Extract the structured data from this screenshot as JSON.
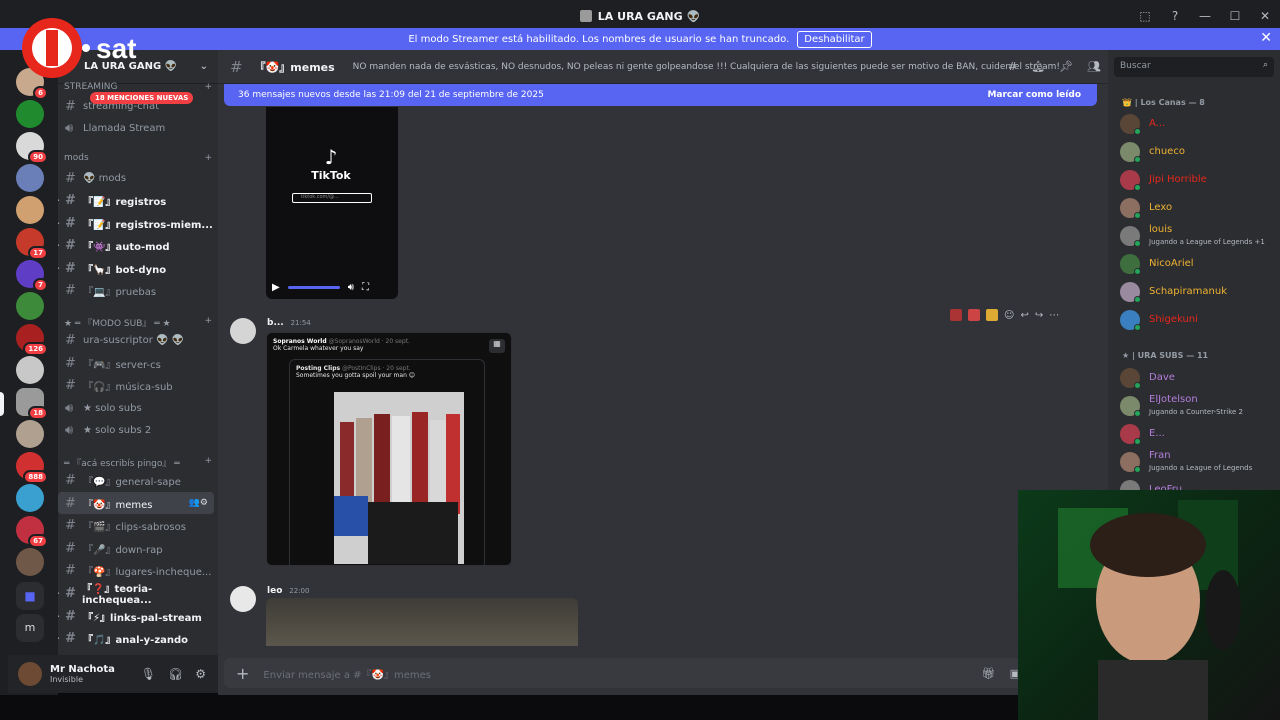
{
  "window": {
    "title": "LA URA GANG 👽",
    "controls": [
      "⬚",
      "?",
      "—",
      "☐",
      "✕"
    ]
  },
  "streamer_banner": {
    "text": "El modo Streamer está habilitado. Los nombres de usuario se han truncado.",
    "button": "Deshabilitar",
    "close": "✕"
  },
  "logo": {
    "text": "I.sat",
    "accent": "#e8271c"
  },
  "server_rail": {
    "badges": [
      "6",
      "90",
      "17",
      "7",
      "126",
      "18",
      "888",
      "67"
    ],
    "dm_label": "m"
  },
  "server": {
    "name": "LA URA GANG 👽",
    "mentions_pill": "18 MENCIONES NUEVAS"
  },
  "categories": {
    "streaming": "STREAMING",
    "mods": "mods",
    "modo_sub": "★ ═ 『MODO SUB』 ═ ★",
    "aca": "═ 『acá escribís pingo』 ═"
  },
  "channels": {
    "streaming_chat": "streaming-chat",
    "llamada_stream": "Llamada Stream",
    "mods": "👽 mods",
    "registros": "『📝』registros",
    "registros_miem": "『📝』registros-miem...",
    "auto_mod": "『👾』auto-mod",
    "bot_dyno": "『🦙』bot-dyno",
    "pruebas": "『💻』pruebas",
    "ura_suscriptor": "ura-suscriptor 👽 👽",
    "server_cs": "『🎮』server-cs",
    "musica_sub": "『🎧』música-sub",
    "solo_subs": "★ solo subs",
    "solo_subs_2": "★ solo subs 2",
    "general_sape": "『💬』general-sape",
    "memes": "『🤡』memes",
    "clips_sabrosos": "『🎬』clips-sabrosos",
    "down_rap": "『🎤』down-rap",
    "lugares": "『🍄』lugares-incheque...",
    "teoria": "『❓』teoria-inchequea...",
    "links": "『⚡』links-pal-stream",
    "anal": "『🎵』anal-y-zando"
  },
  "user": {
    "name": "Mr Nachota",
    "status": "Invisible"
  },
  "channel_header": {
    "name": "『🤡』memes",
    "topic": "NO manden nada de esvásticas, NO desnudos, NO peleas ni gente golpeandose !!! Cualquiera de las siguientes puede ser motivo de BAN, cuiden el stream!"
  },
  "new_messages": {
    "text": "36 mensajes nuevos desde las 21:09 del 21 de septiembre de 2025",
    "action": "Marcar como leído"
  },
  "video_embed": {
    "brand": "TikTok",
    "url_bar": "tiktok.com/@..."
  },
  "messages": [
    {
      "author": "b...",
      "time": "21:54"
    },
    {
      "author": "leo",
      "time": "22:00"
    }
  ],
  "tweet": {
    "outer_author": "Sopranos World",
    "outer_handle": "@SopranosWorld · 20 sept.",
    "outer_text": "Ok Carmela whatever you say",
    "inner_author": "Posting Clips",
    "inner_handle": "@PostInClips · 20 sept.",
    "inner_text": "Sometimes you gotta spoil your man 😊"
  },
  "composer": {
    "placeholder": "Enviar mensaje a #『🤡』memes"
  },
  "members": {
    "search_placeholder": "Buscar",
    "group1": "👑 | Los Canas — 8",
    "group2": "★ | URA SUBS — 11",
    "list1": [
      {
        "name": "A...",
        "color": "#e8271c",
        "activity": ""
      },
      {
        "name": "chueco",
        "color": "#f0b232",
        "activity": ""
      },
      {
        "name": "Jipi Horrible",
        "color": "#e8271c",
        "activity": ""
      },
      {
        "name": "Lexo",
        "color": "#f0b232",
        "activity": ""
      },
      {
        "name": "louis",
        "color": "#f0b232",
        "activity": "Jugando a League of Legends +1"
      },
      {
        "name": "NicoAriel",
        "color": "#f0b232",
        "activity": ""
      },
      {
        "name": "Schapiramanuk",
        "color": "#f0b232",
        "activity": ""
      },
      {
        "name": "Shigekuni",
        "color": "#e8271c",
        "activity": ""
      }
    ],
    "list2": [
      {
        "name": "Dave",
        "color": "#b57edc",
        "activity": ""
      },
      {
        "name": "ElJotelson",
        "color": "#b57edc",
        "activity": "Jugando a Counter-Strike 2"
      },
      {
        "name": "E...",
        "color": "#b57edc",
        "activity": ""
      },
      {
        "name": "Fran",
        "color": "#b57edc",
        "activity": "Jugando a League of Legends"
      },
      {
        "name": "LeoFru",
        "color": "#b57edc",
        "activity": ""
      }
    ]
  },
  "colors": {
    "blurple": "#5865f2",
    "red": "#f23f43",
    "online": "#23a55a"
  }
}
